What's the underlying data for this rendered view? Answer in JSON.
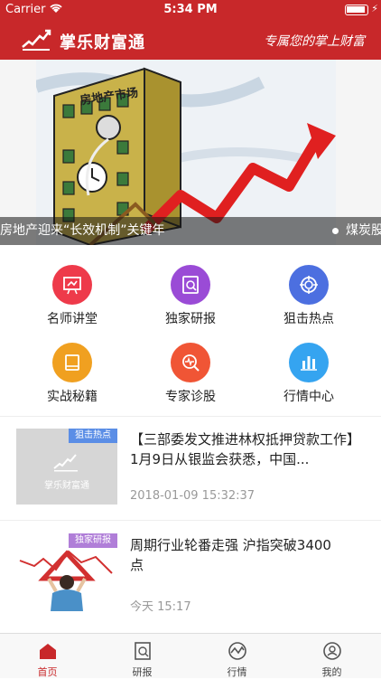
{
  "status": {
    "carrier": "Carrier",
    "time": "5:34 PM"
  },
  "nav": {
    "app_name": "掌乐财富通",
    "slogan": "专属您的掌上财富"
  },
  "banner": {
    "caption": "房地产迎来“长效机制”关键年",
    "next_caption": "煤炭股",
    "image_text": "房地产市场"
  },
  "grid": [
    {
      "label": "名师讲堂",
      "color": "#ee3a4a",
      "icon": "teacher-board-icon"
    },
    {
      "label": "独家研报",
      "color": "#9a4bd6",
      "icon": "research-doc-icon"
    },
    {
      "label": "狙击热点",
      "color": "#4c6fe0",
      "icon": "target-icon"
    },
    {
      "label": "实战秘籍",
      "color": "#f0a020",
      "icon": "book-icon"
    },
    {
      "label": "专家诊股",
      "color": "#f05535",
      "icon": "diagnose-search-icon"
    },
    {
      "label": "行情中心",
      "color": "#35a4f0",
      "icon": "bar-chart-icon"
    }
  ],
  "news": [
    {
      "tag": "狙击热点",
      "tag_color": "#5b8ee6",
      "thumb_text": "掌乐财富通",
      "title": "【三部委发文推进林权抵押贷款工作】1月9日从银监会获悉，中国...",
      "time": "2018-01-09 15:32:37"
    },
    {
      "tag": "独家研报",
      "tag_color": "#b07ed8",
      "title": "周期行业轮番走强 沪指突破3400 点",
      "time": "今天 15:17"
    }
  ],
  "tabs": [
    {
      "label": "首页",
      "icon": "home-icon",
      "active": true
    },
    {
      "label": "研报",
      "icon": "report-icon"
    },
    {
      "label": "行情",
      "icon": "market-icon"
    },
    {
      "label": "我的",
      "icon": "profile-icon"
    }
  ],
  "colors": {
    "brand": "#c8282a",
    "muted": "#999999"
  }
}
